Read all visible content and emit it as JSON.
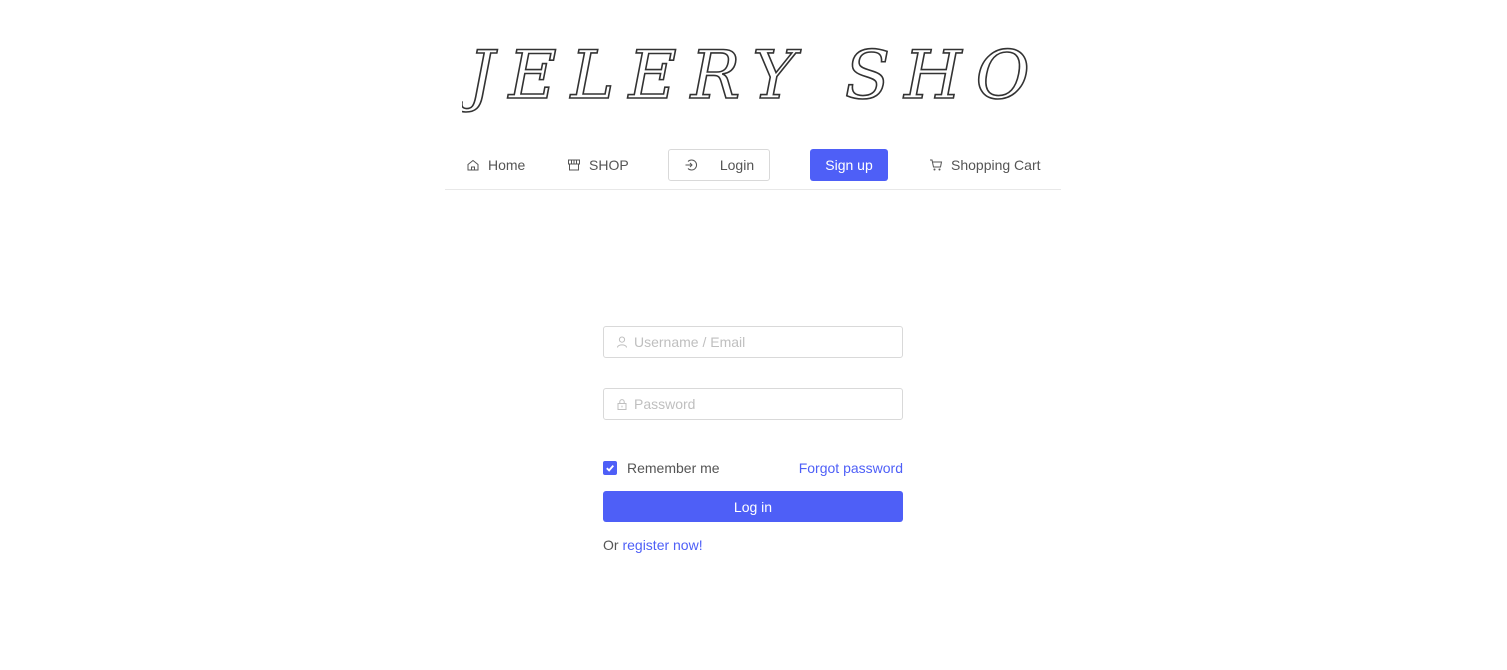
{
  "brand": {
    "logo_text": "JELERY SHOP"
  },
  "nav": {
    "items": [
      {
        "label": "Home",
        "icon": "home-icon"
      },
      {
        "label": "SHOP",
        "icon": "shop-icon"
      },
      {
        "label": "Login",
        "icon": "login-icon"
      },
      {
        "label": "Sign up"
      },
      {
        "label": "Shopping Cart",
        "icon": "cart-icon"
      }
    ]
  },
  "form": {
    "username_placeholder": "Username / Email",
    "password_placeholder": "Password",
    "remember_label": "Remember me",
    "remember_checked": true,
    "forgot_label": "Forgot password",
    "submit_label": "Log in",
    "register_prefix": "Or",
    "register_link": "register now!"
  },
  "colors": {
    "primary": "#4e5ff7",
    "text": "#555555",
    "border": "#d9d9d9",
    "placeholder": "#bfbfbf"
  }
}
